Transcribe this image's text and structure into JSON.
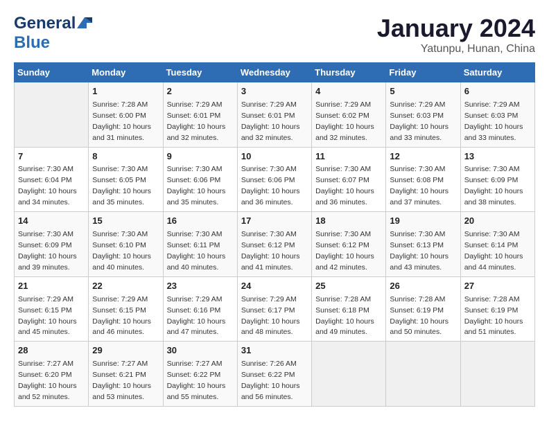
{
  "header": {
    "logo_general": "General",
    "logo_blue": "Blue",
    "title": "January 2024",
    "subtitle": "Yatunpu, Hunan, China"
  },
  "weekdays": [
    "Sunday",
    "Monday",
    "Tuesday",
    "Wednesday",
    "Thursday",
    "Friday",
    "Saturday"
  ],
  "weeks": [
    [
      {
        "day": "",
        "info": ""
      },
      {
        "day": "1",
        "info": "Sunrise: 7:28 AM\nSunset: 6:00 PM\nDaylight: 10 hours\nand 31 minutes."
      },
      {
        "day": "2",
        "info": "Sunrise: 7:29 AM\nSunset: 6:01 PM\nDaylight: 10 hours\nand 32 minutes."
      },
      {
        "day": "3",
        "info": "Sunrise: 7:29 AM\nSunset: 6:01 PM\nDaylight: 10 hours\nand 32 minutes."
      },
      {
        "day": "4",
        "info": "Sunrise: 7:29 AM\nSunset: 6:02 PM\nDaylight: 10 hours\nand 32 minutes."
      },
      {
        "day": "5",
        "info": "Sunrise: 7:29 AM\nSunset: 6:03 PM\nDaylight: 10 hours\nand 33 minutes."
      },
      {
        "day": "6",
        "info": "Sunrise: 7:29 AM\nSunset: 6:03 PM\nDaylight: 10 hours\nand 33 minutes."
      }
    ],
    [
      {
        "day": "7",
        "info": "Sunrise: 7:30 AM\nSunset: 6:04 PM\nDaylight: 10 hours\nand 34 minutes."
      },
      {
        "day": "8",
        "info": "Sunrise: 7:30 AM\nSunset: 6:05 PM\nDaylight: 10 hours\nand 35 minutes."
      },
      {
        "day": "9",
        "info": "Sunrise: 7:30 AM\nSunset: 6:06 PM\nDaylight: 10 hours\nand 35 minutes."
      },
      {
        "day": "10",
        "info": "Sunrise: 7:30 AM\nSunset: 6:06 PM\nDaylight: 10 hours\nand 36 minutes."
      },
      {
        "day": "11",
        "info": "Sunrise: 7:30 AM\nSunset: 6:07 PM\nDaylight: 10 hours\nand 36 minutes."
      },
      {
        "day": "12",
        "info": "Sunrise: 7:30 AM\nSunset: 6:08 PM\nDaylight: 10 hours\nand 37 minutes."
      },
      {
        "day": "13",
        "info": "Sunrise: 7:30 AM\nSunset: 6:09 PM\nDaylight: 10 hours\nand 38 minutes."
      }
    ],
    [
      {
        "day": "14",
        "info": "Sunrise: 7:30 AM\nSunset: 6:09 PM\nDaylight: 10 hours\nand 39 minutes."
      },
      {
        "day": "15",
        "info": "Sunrise: 7:30 AM\nSunset: 6:10 PM\nDaylight: 10 hours\nand 40 minutes."
      },
      {
        "day": "16",
        "info": "Sunrise: 7:30 AM\nSunset: 6:11 PM\nDaylight: 10 hours\nand 40 minutes."
      },
      {
        "day": "17",
        "info": "Sunrise: 7:30 AM\nSunset: 6:12 PM\nDaylight: 10 hours\nand 41 minutes."
      },
      {
        "day": "18",
        "info": "Sunrise: 7:30 AM\nSunset: 6:12 PM\nDaylight: 10 hours\nand 42 minutes."
      },
      {
        "day": "19",
        "info": "Sunrise: 7:30 AM\nSunset: 6:13 PM\nDaylight: 10 hours\nand 43 minutes."
      },
      {
        "day": "20",
        "info": "Sunrise: 7:30 AM\nSunset: 6:14 PM\nDaylight: 10 hours\nand 44 minutes."
      }
    ],
    [
      {
        "day": "21",
        "info": "Sunrise: 7:29 AM\nSunset: 6:15 PM\nDaylight: 10 hours\nand 45 minutes."
      },
      {
        "day": "22",
        "info": "Sunrise: 7:29 AM\nSunset: 6:15 PM\nDaylight: 10 hours\nand 46 minutes."
      },
      {
        "day": "23",
        "info": "Sunrise: 7:29 AM\nSunset: 6:16 PM\nDaylight: 10 hours\nand 47 minutes."
      },
      {
        "day": "24",
        "info": "Sunrise: 7:29 AM\nSunset: 6:17 PM\nDaylight: 10 hours\nand 48 minutes."
      },
      {
        "day": "25",
        "info": "Sunrise: 7:28 AM\nSunset: 6:18 PM\nDaylight: 10 hours\nand 49 minutes."
      },
      {
        "day": "26",
        "info": "Sunrise: 7:28 AM\nSunset: 6:19 PM\nDaylight: 10 hours\nand 50 minutes."
      },
      {
        "day": "27",
        "info": "Sunrise: 7:28 AM\nSunset: 6:19 PM\nDaylight: 10 hours\nand 51 minutes."
      }
    ],
    [
      {
        "day": "28",
        "info": "Sunrise: 7:27 AM\nSunset: 6:20 PM\nDaylight: 10 hours\nand 52 minutes."
      },
      {
        "day": "29",
        "info": "Sunrise: 7:27 AM\nSunset: 6:21 PM\nDaylight: 10 hours\nand 53 minutes."
      },
      {
        "day": "30",
        "info": "Sunrise: 7:27 AM\nSunset: 6:22 PM\nDaylight: 10 hours\nand 55 minutes."
      },
      {
        "day": "31",
        "info": "Sunrise: 7:26 AM\nSunset: 6:22 PM\nDaylight: 10 hours\nand 56 minutes."
      },
      {
        "day": "",
        "info": ""
      },
      {
        "day": "",
        "info": ""
      },
      {
        "day": "",
        "info": ""
      }
    ]
  ]
}
